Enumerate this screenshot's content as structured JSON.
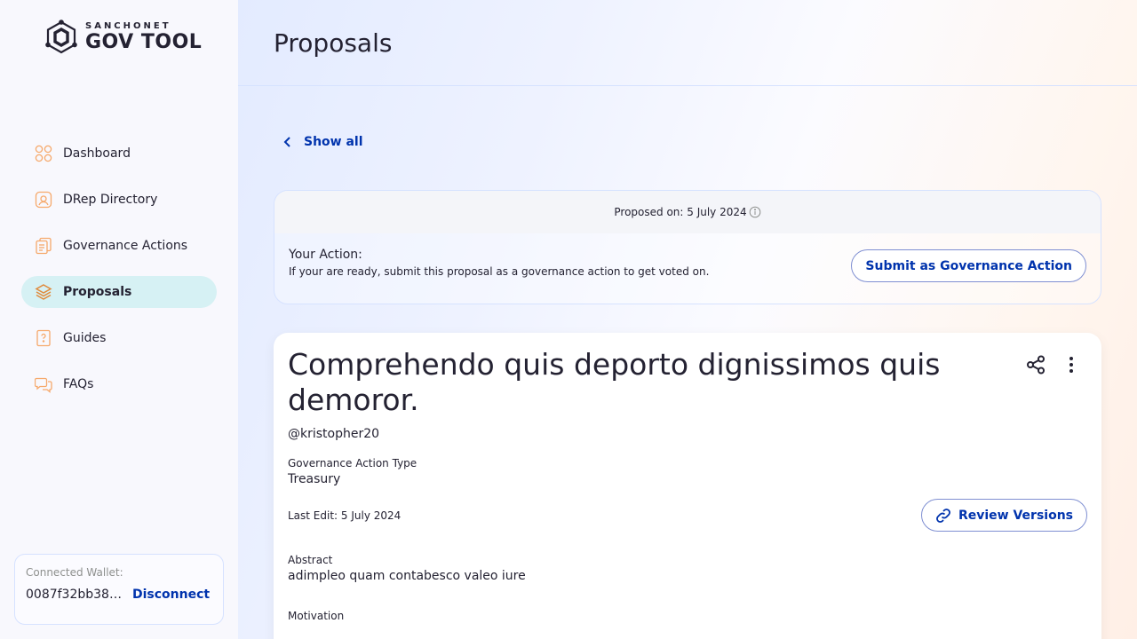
{
  "logo": {
    "top": "SANCHONET",
    "main": "GOV TOOL"
  },
  "nav": [
    {
      "label": "Dashboard",
      "icon": "dashboard-icon"
    },
    {
      "label": "DRep Directory",
      "icon": "drep-directory-icon"
    },
    {
      "label": "Governance Actions",
      "icon": "governance-actions-icon"
    },
    {
      "label": "Proposals",
      "icon": "proposals-icon",
      "active": true
    },
    {
      "label": "Guides",
      "icon": "guides-icon"
    },
    {
      "label": "FAQs",
      "icon": "faqs-icon"
    }
  ],
  "wallet": {
    "label": "Connected Wallet:",
    "address": "0087f32bb38a...",
    "disconnect": "Disconnect"
  },
  "header": {
    "title": "Proposals"
  },
  "back": {
    "label": "Show all"
  },
  "action_card": {
    "proposed_on": "Proposed on: 5 July 2024",
    "title": "Your Action:",
    "description": "If your are ready, submit this proposal as a governance action to get voted on.",
    "submit_label": "Submit as Governance Action"
  },
  "proposal": {
    "title": "Comprehendo quis deporto dignissimos quis demoror.",
    "author": "@kristopher20",
    "type_label": "Governance Action Type",
    "type_value": "Treasury",
    "last_edit": "Last Edit: 5 July 2024",
    "review_label": "Review Versions",
    "abstract_label": "Abstract",
    "abstract_value": "adimpleo quam contabesco valeo iure",
    "motivation_label": "Motivation"
  },
  "colors": {
    "accent": "#0033ad",
    "active_nav": "#d6f1f4",
    "text": "#242232",
    "icon_orange": "#f6a96b"
  }
}
